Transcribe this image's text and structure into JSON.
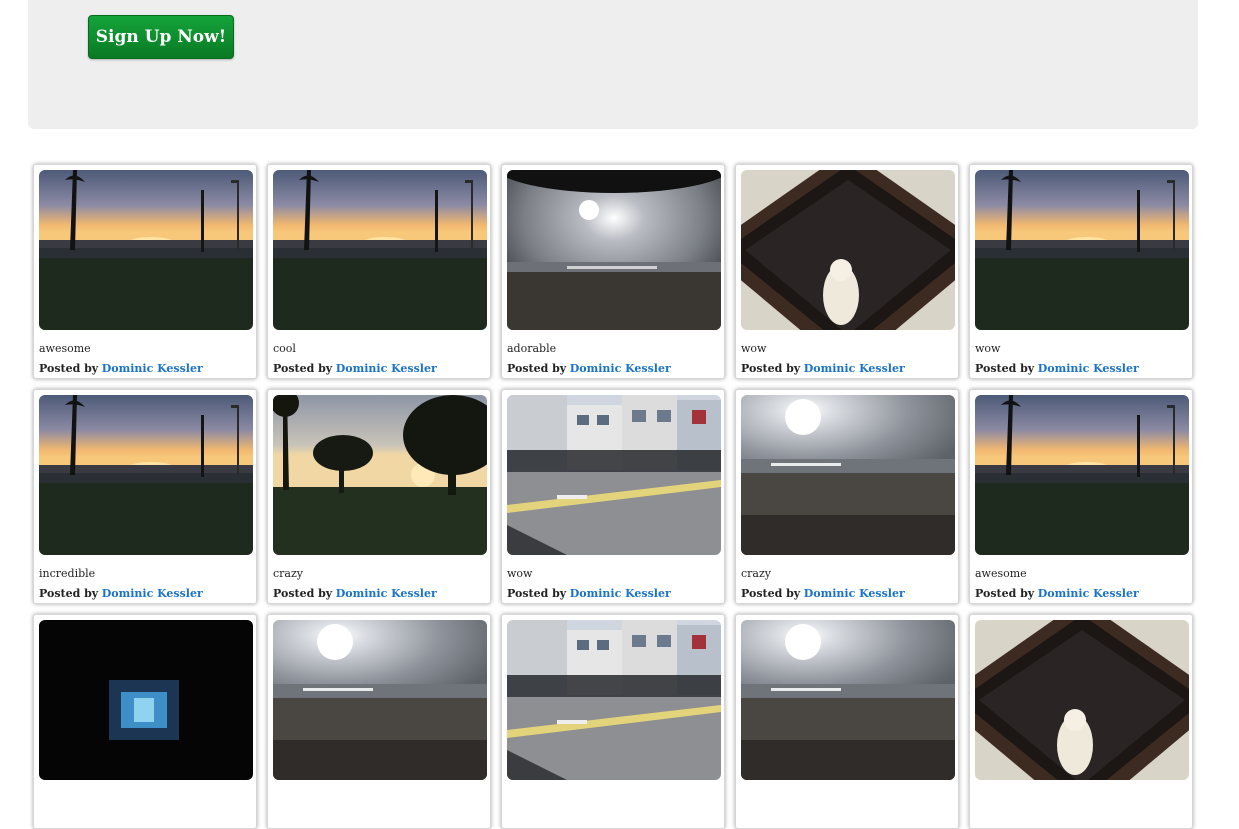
{
  "banner": {
    "signup_label": "Sign Up Now!"
  },
  "posted_by_label": "Posted by",
  "cards": [
    {
      "caption": "awesome",
      "author": "Dominic Kessler",
      "scene": "sunset-park"
    },
    {
      "caption": "cool",
      "author": "Dominic Kessler",
      "scene": "sunset-park"
    },
    {
      "caption": "adorable",
      "author": "Dominic Kessler",
      "scene": "beach-vignette"
    },
    {
      "caption": "wow",
      "author": "Dominic Kessler",
      "scene": "framed-portrait"
    },
    {
      "caption": "wow",
      "author": "Dominic Kessler",
      "scene": "sunset-park"
    },
    {
      "caption": "incredible",
      "author": "Dominic Kessler",
      "scene": "sunset-park"
    },
    {
      "caption": "crazy",
      "author": "Dominic Kessler",
      "scene": "palm-sunset"
    },
    {
      "caption": "wow",
      "author": "Dominic Kessler",
      "scene": "street"
    },
    {
      "caption": "crazy",
      "author": "Dominic Kessler",
      "scene": "beach"
    },
    {
      "caption": "awesome",
      "author": "Dominic Kessler",
      "scene": "sunset-park"
    },
    {
      "caption": "",
      "author": "",
      "scene": "dark-screen"
    },
    {
      "caption": "",
      "author": "",
      "scene": "beach"
    },
    {
      "caption": "",
      "author": "",
      "scene": "street"
    },
    {
      "caption": "",
      "author": "",
      "scene": "beach"
    },
    {
      "caption": "",
      "author": "",
      "scene": "framed-portrait"
    }
  ]
}
